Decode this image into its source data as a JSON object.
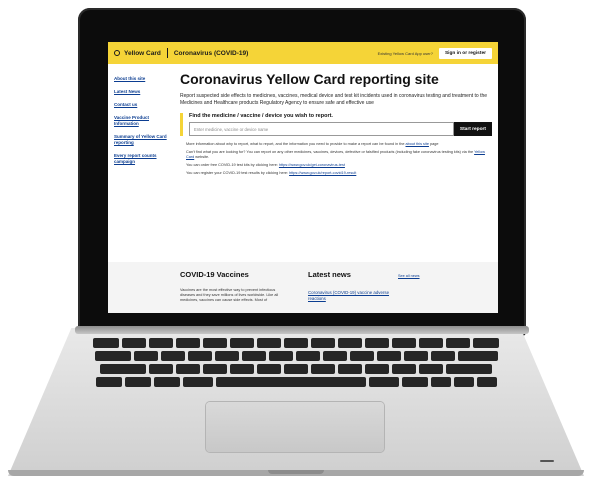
{
  "header": {
    "brand": "Yellow Card",
    "section": "Coronavirus (COVID-19)",
    "existing_user": "Existing Yellow Card App user?",
    "signin": "Sign in or register"
  },
  "sidebar": {
    "items": [
      {
        "label": "About this site"
      },
      {
        "label": "Latest News"
      },
      {
        "label": "Contact us"
      },
      {
        "label": "Vaccine Product Information"
      },
      {
        "label": "Summary of Yellow Card reporting"
      },
      {
        "label": "Every report counts campaign"
      }
    ]
  },
  "main": {
    "title": "Coronavirus Yellow Card reporting site",
    "lead": "Report suspected side effects to medicines, vaccines, medical device and test kit incidents used in coronavirus testing and treatment to the Medicines and Healthcare products Regulatory Agency to ensure safe and effective use",
    "search": {
      "label": "Find the medicine / vaccine / device you wish to report.",
      "placeholder": "Enter medicine, vaccine or device name",
      "button": "Start report"
    },
    "info": [
      {
        "text": "More information about why to report, what to report, and the information you need to provide to make a report can be found in the ",
        "link": "about this site",
        "after": " page"
      },
      {
        "text": "Can't find what you are looking for? You can report on any other medicines, vaccines, devices, defective or falsified products (including fake coronavirus testing kits) via the ",
        "link": "Yellow Card",
        "after": " website."
      },
      {
        "text": "You can order free COVID-19 test kits by clicking here: ",
        "link": "https://www.gov.uk/get-coronavirus-test",
        "after": ""
      },
      {
        "text": "You can register your COVID-19 test results by clicking here: ",
        "link": "https://www.gov.uk/report-covid19-result",
        "after": ""
      }
    ]
  },
  "lower": {
    "vaccines_title": "COVID-19 Vaccines",
    "vaccines_text": "Vaccines are the most effective way to prevent infectious diseases and they save millions of lives worldwide. Like all medicines, vaccines can cause side effects. Most of",
    "news_title": "Latest news",
    "see_all": "See all news",
    "news_item": "Coronavirus (COVID-19) vaccine adverse reactions"
  }
}
